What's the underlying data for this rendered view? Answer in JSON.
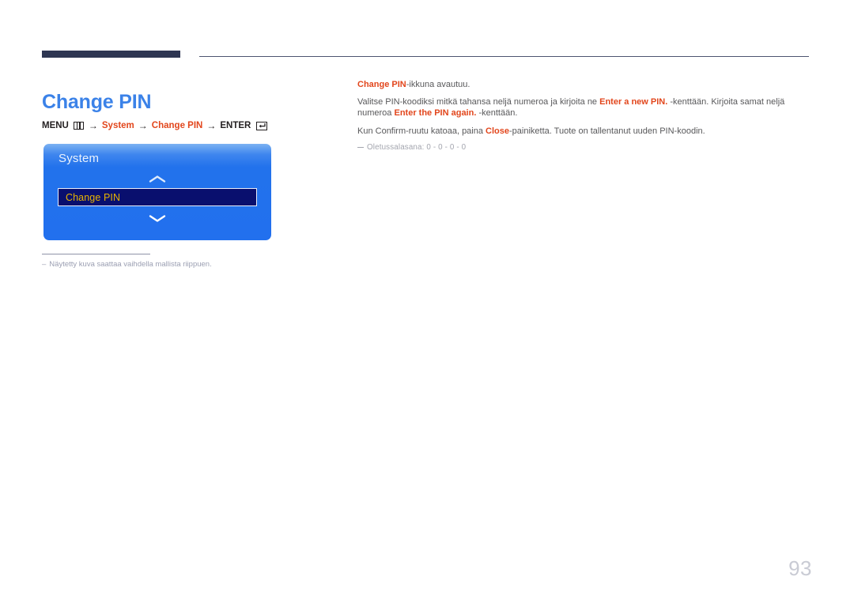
{
  "header": {
    "rule_color_thick": "#2e3652",
    "rule_color_thin": "#4d5470"
  },
  "page_title": "Change PIN",
  "breadcrumb": {
    "menu_label": "MENU",
    "menu_icon": "menu-grid-icon",
    "arrow": "→",
    "step_system": "System",
    "step_change_pin": "Change PIN",
    "enter_label": "ENTER",
    "enter_icon": "enter-return-icon",
    "accent_color": "#e2461c"
  },
  "osd": {
    "title": "System",
    "chevron_up_icon": "chevron-up-icon",
    "chevron_down_icon": "chevron-down-icon",
    "selected_row": "Change PIN",
    "highlight_fill": "#090f6e",
    "highlight_text_color": "#e8b400"
  },
  "image_footnote": {
    "dash": "–",
    "text": "Näytetty kuva saattaa vaihdella mallista riippuen."
  },
  "body": {
    "p1_lead": "Change PIN",
    "p1_rest": "-ikkuna avautuu.",
    "p2_a": "Valitse PIN-koodiksi mitkä tahansa neljä numeroa ja kirjoita ne ",
    "p2_b": "Enter a new PIN.",
    "p2_c": " -kenttään. Kirjoita samat neljä numeroa ",
    "p2_d": "Enter the PIN again.",
    "p2_e": " -kenttään.",
    "p3_a": "Kun Confirm-ruutu katoaa, paina ",
    "p3_b": "Close",
    "p3_c": "-painiketta. Tuote on tallentanut uuden PIN-koodin.",
    "note": "Oletussalasana: 0 - 0 - 0 - 0"
  },
  "page_number": "93"
}
